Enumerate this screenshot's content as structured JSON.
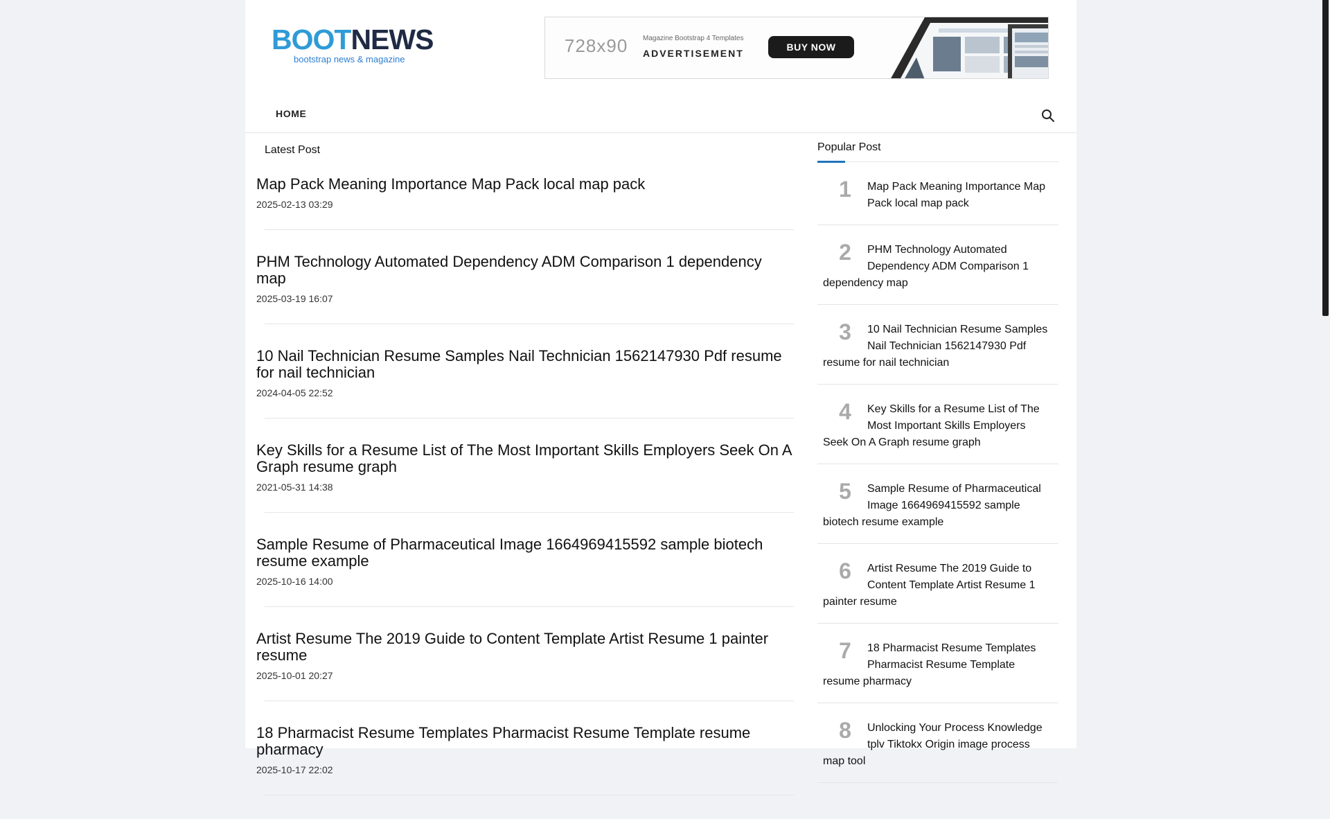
{
  "header": {
    "logo_part1": "B",
    "logo_part2": "OOT",
    "logo_part3": "NEWS",
    "logo_tagline": "bootstrap news & magazine"
  },
  "ad": {
    "size": "728x90",
    "subtitle": "Magazine Bootstrap 4 Templates",
    "label": "ADVERTISEMENT",
    "buy_label": "BUY NOW"
  },
  "nav": {
    "home": "HOME",
    "search_icon": "search-icon"
  },
  "latest": {
    "title": "Latest Post",
    "posts": [
      {
        "title": "Map Pack Meaning Importance Map Pack local map pack",
        "date": "2025-02-13 03:29"
      },
      {
        "title": "PHM Technology Automated Dependency ADM Comparison 1 dependency map",
        "date": "2025-03-19 16:07"
      },
      {
        "title": "10 Nail Technician Resume Samples Nail Technician 1562147930 Pdf resume for nail technician",
        "date": "2024-04-05 22:52"
      },
      {
        "title": "Key Skills for a Resume List of The Most Important Skills Employers Seek On A Graph resume graph",
        "date": "2021-05-31 14:38"
      },
      {
        "title": "Sample Resume of Pharmaceutical Image 1664969415592 sample biotech resume example",
        "date": "2025-10-16 14:00"
      },
      {
        "title": "Artist Resume The 2019 Guide to Content Template Artist Resume 1 painter resume",
        "date": "2025-10-01 20:27"
      },
      {
        "title": "18 Pharmacist Resume Templates Pharmacist Resume Template resume pharmacy",
        "date": "2025-10-17 22:02"
      }
    ]
  },
  "popular": {
    "title": "Popular Post",
    "items": [
      {
        "num": "1",
        "title": "Map Pack Meaning Importance Map Pack local map pack"
      },
      {
        "num": "2",
        "title": "PHM Technology Automated Dependency ADM Comparison 1 dependency map"
      },
      {
        "num": "3",
        "title": "10 Nail Technician Resume Samples Nail Technician 1562147930 Pdf resume for nail technician"
      },
      {
        "num": "4",
        "title": "Key Skills for a Resume List of The Most Important Skills Employers Seek On A Graph resume graph"
      },
      {
        "num": "5",
        "title": "Sample Resume of Pharmaceutical Image 1664969415592 sample biotech resume example"
      },
      {
        "num": "6",
        "title": "Artist Resume The 2019 Guide to Content Template Artist Resume 1 painter resume"
      },
      {
        "num": "7",
        "title": "18 Pharmacist Resume Templates Pharmacist Resume Template resume pharmacy"
      },
      {
        "num": "8",
        "title": "Unlocking Your Process Knowledge tplv Tiktokx Origin image process map tool"
      }
    ]
  },
  "colors": {
    "brand_blue": "#2f9bd7",
    "brand_dark": "#1f2a44",
    "accent": "#1e73be",
    "rank_gray": "#aaaaaa"
  }
}
